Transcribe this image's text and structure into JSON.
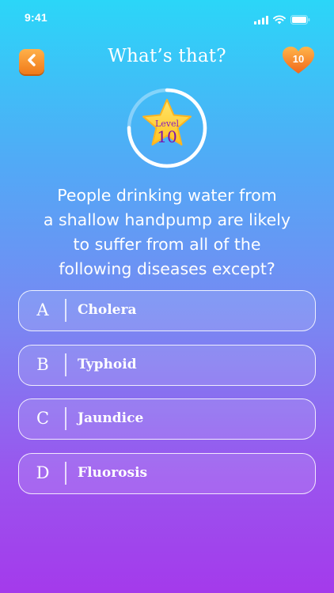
{
  "status_bar": {
    "time": "9:41",
    "icons": [
      "signal-icon",
      "wifi-icon",
      "battery-icon"
    ]
  },
  "header": {
    "back_icon": "chevron-left-icon",
    "title": "What’s that?",
    "lives": "10",
    "lives_icon": "heart-icon"
  },
  "level": {
    "label": "Level",
    "number": "10",
    "progress": 0.75
  },
  "question": {
    "text": "People drinking water from\na shallow handpump are likely\nto suffer from all of the\nfollowing  diseases except?"
  },
  "answers": [
    {
      "letter": "A",
      "text": "Cholera"
    },
    {
      "letter": "B",
      "text": "Typhoid"
    },
    {
      "letter": "C",
      "text": "Jaundice"
    },
    {
      "letter": "D",
      "text": "Fluorosis"
    }
  ],
  "colors": {
    "gradient_top": "#2bd6f8",
    "gradient_bottom": "#a43aeb",
    "back_button": "#f5891f",
    "heart": "#f6821f",
    "star": "#ffd53d",
    "level_text": "#7b12ad"
  }
}
